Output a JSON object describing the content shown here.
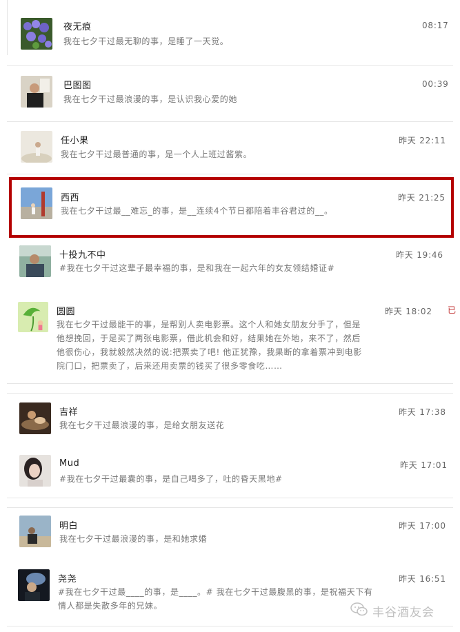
{
  "posts": [
    {
      "name": "夜无痕",
      "time": "08:17",
      "text": "我在七夕干过最无聊的事，是睡了一天觉。"
    },
    {
      "name": "巴图图",
      "time": "00:39",
      "text": "我在七夕干过最浪漫的事，是认识我心爱的她"
    },
    {
      "name": "任小果",
      "time": "昨天 22:11",
      "text": "我在七夕干过最普通的事，是一个人上班过酱紫。"
    },
    {
      "name": "西西",
      "time": "昨天 21:25",
      "text": "我在七夕干过最__难忘_的事，是__连续4个节日都陪着丰谷君过的__。"
    },
    {
      "name": "十投九不中",
      "time": "昨天 19:46",
      "text": "#我在七夕干过这辈子最幸福的事，是和我在一起六年的女友领结婚证#"
    },
    {
      "name": "圆圆",
      "time": "昨天 18:02",
      "text_lines": [
        "我在七夕干过最能干的事，是帮别人卖电影票。这个人和她女朋友分手了，但是",
        "他想挽回，于是买了两张电影票，借此机会和好，结果她在外地，来不了，然后",
        "他很伤心，我就毅然决然的说:把票卖了吧! 他正犹豫，我果断的拿着票冲到电影",
        "院门口，把票卖了，后来还用卖票的钱买了很多零食吃……"
      ]
    },
    {
      "name": "吉祥",
      "time": "昨天 17:38",
      "text": "我在七夕干过最浪漫的事，是给女朋友送花"
    },
    {
      "name": "Mud",
      "time": "昨天 17:01",
      "text": "#我在七夕干过最囊的事，是自己喝多了，吐的昏天黑地#"
    },
    {
      "name": "明白",
      "time": "昨天 17:00",
      "text": "我在七夕干过最浪漫的事，是和她求婚"
    },
    {
      "name": "尧尧",
      "time": "昨天 16:51",
      "text_lines": [
        "#我在七夕干过最____的事，是____。# 我在七夕干过最腹黑的事，是祝福天下有",
        "情人都是失散多年的兄妹。"
      ]
    }
  ],
  "edge_glyph": "已",
  "watermark": "丰谷酒友会",
  "colors": {
    "highlight": "#b40000",
    "text": "#777777",
    "name": "#222222"
  },
  "icons": [
    "wechat-icon"
  ]
}
